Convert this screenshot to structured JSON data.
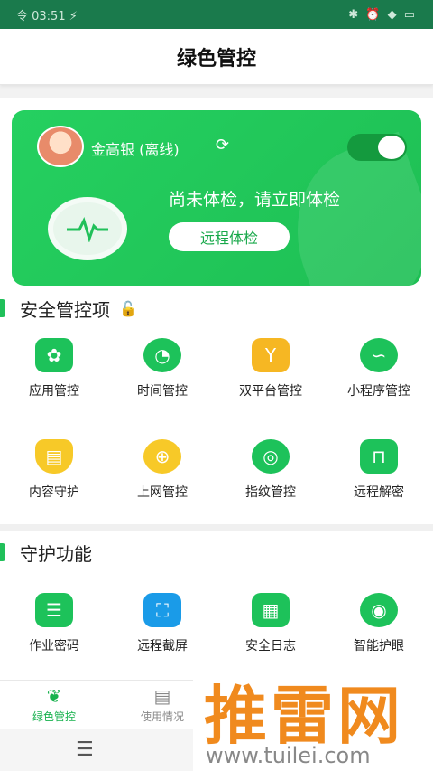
{
  "status_bar": {
    "left": "令 03:51 ⚡",
    "right": "✱ ⏰ ◆ ▭"
  },
  "header": {
    "title": "绿色管控"
  },
  "card": {
    "username": "金高银 (离线)",
    "refresh_icon": "refresh-icon",
    "status_text": "尚未体检，请立即体检",
    "check_button": "远程体检"
  },
  "section1": {
    "title": "安全管控项",
    "items": [
      {
        "label": "应用管控",
        "color": "#1dc25a",
        "glyph": "✿"
      },
      {
        "label": "时间管控",
        "color": "#1dc25a",
        "glyph": "◔"
      },
      {
        "label": "双平台管控",
        "color": "#f6b723",
        "glyph": "Y"
      },
      {
        "label": "小程序管控",
        "color": "#1dc25a",
        "glyph": "∽"
      },
      {
        "label": "内容守护",
        "color": "#f7c928",
        "glyph": "▤"
      },
      {
        "label": "上网管控",
        "color": "#f7c928",
        "glyph": "⊕"
      },
      {
        "label": "指纹管控",
        "color": "#1dc25a",
        "glyph": "◎"
      },
      {
        "label": "远程解密",
        "color": "#1dc25a",
        "glyph": "⊓"
      }
    ]
  },
  "section2": {
    "title": "守护功能",
    "items": [
      {
        "label": "作业密码",
        "color": "#1dc25a",
        "glyph": "☰"
      },
      {
        "label": "远程截屏",
        "color": "#1a9be8",
        "glyph": "⛶"
      },
      {
        "label": "安全日志",
        "color": "#1dc25a",
        "glyph": "▦"
      },
      {
        "label": "智能护眼",
        "color": "#1dc25a",
        "glyph": "◉"
      }
    ]
  },
  "tabs": [
    {
      "label": "绿色管控",
      "glyph": "❦"
    },
    {
      "label": "使用情况",
      "glyph": "▤"
    }
  ],
  "watermark": {
    "text": "推雷网",
    "url": "www.tuilei.com"
  }
}
